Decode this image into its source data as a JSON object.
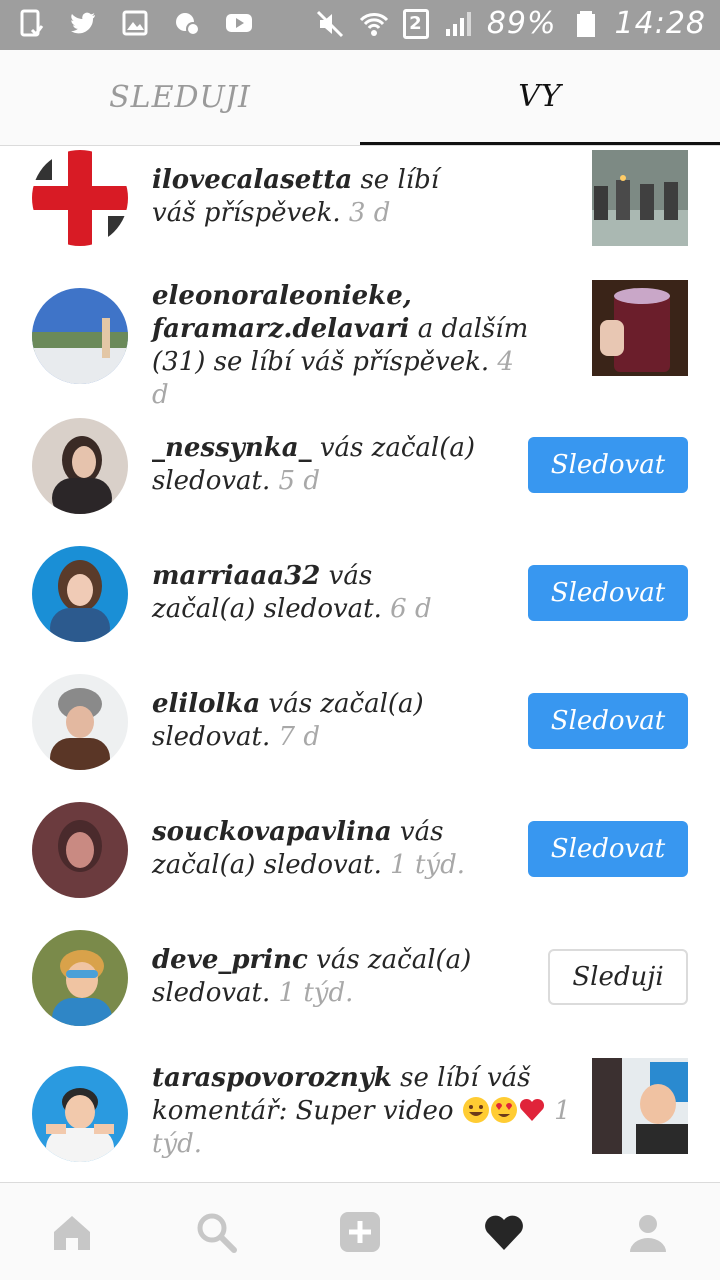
{
  "status_bar": {
    "battery": "89%",
    "time": "14:28",
    "sim_slot": "2",
    "icons_left": [
      "screenshot-icon",
      "twitter-icon",
      "image-icon",
      "sync-icon",
      "youtube-icon"
    ],
    "icons_right": [
      "mute-icon",
      "wifi-icon",
      "sim-icon",
      "signal-icon",
      "battery-icon"
    ]
  },
  "tabs": {
    "following_label": "SLEDUJI",
    "you_label": "VY",
    "active": "you"
  },
  "notifications": [
    {
      "username": "ilovecalasetta",
      "action": " se líbí váš příspěvek.",
      "time": " 3 d",
      "avatar_icon": "flag-avatar",
      "right": "thumbnail",
      "thumb_desc": "candles-thumbnail"
    },
    {
      "username": "eleonoraleonieke,",
      "username2": "faramarz.delavari",
      "action": " a dalším (31) se líbí váš příspěvek.",
      "time": " 4 d",
      "avatar_icon": "landscape-avatar",
      "right": "thumbnail",
      "thumb_desc": "hand-cup-thumbnail"
    },
    {
      "username": "_nessynka_",
      "action": " vás začal(a) sledovat.",
      "time": " 5 d",
      "avatar_icon": "user-avatar",
      "right": "follow",
      "button_label": "Sledovat"
    },
    {
      "username": "marriaaa32",
      "action": " vás začal(a) sledovat.",
      "time": " 6 d",
      "avatar_icon": "user-avatar",
      "right": "follow",
      "button_label": "Sledovat"
    },
    {
      "username": "elilolka",
      "action": " vás začal(a) sledovat.",
      "time": " 7 d",
      "avatar_icon": "user-avatar",
      "right": "follow",
      "button_label": "Sledovat"
    },
    {
      "username": "souckovapavlina",
      "action": " vás začal(a) sledovat.",
      "time": " 1 týd.",
      "avatar_icon": "user-avatar",
      "right": "follow",
      "button_label": "Sledovat"
    },
    {
      "username": "deve_princ",
      "action": " vás začal(a) sledovat.",
      "time": " 1 týd.",
      "avatar_icon": "user-avatar",
      "right": "following",
      "button_label": "Sleduji"
    },
    {
      "username": "taraspovoroznyk",
      "action": " se líbí váš komentář: Super video ",
      "emojis": [
        "joy-emoji",
        "heart-eyes-emoji",
        "red-heart-emoji"
      ],
      "time": " 1 týd.",
      "avatar_icon": "user-avatar",
      "right": "thumbnail",
      "thumb_desc": "video-thumbnail"
    }
  ],
  "bottom_nav": [
    "home-icon",
    "search-icon",
    "add-post-icon",
    "activity-heart-icon",
    "profile-icon"
  ],
  "colors": {
    "follow_button": "#3897f0",
    "status_bar": "#9e9e9e",
    "text": "#262626",
    "time_text": "#a8a8a8"
  }
}
